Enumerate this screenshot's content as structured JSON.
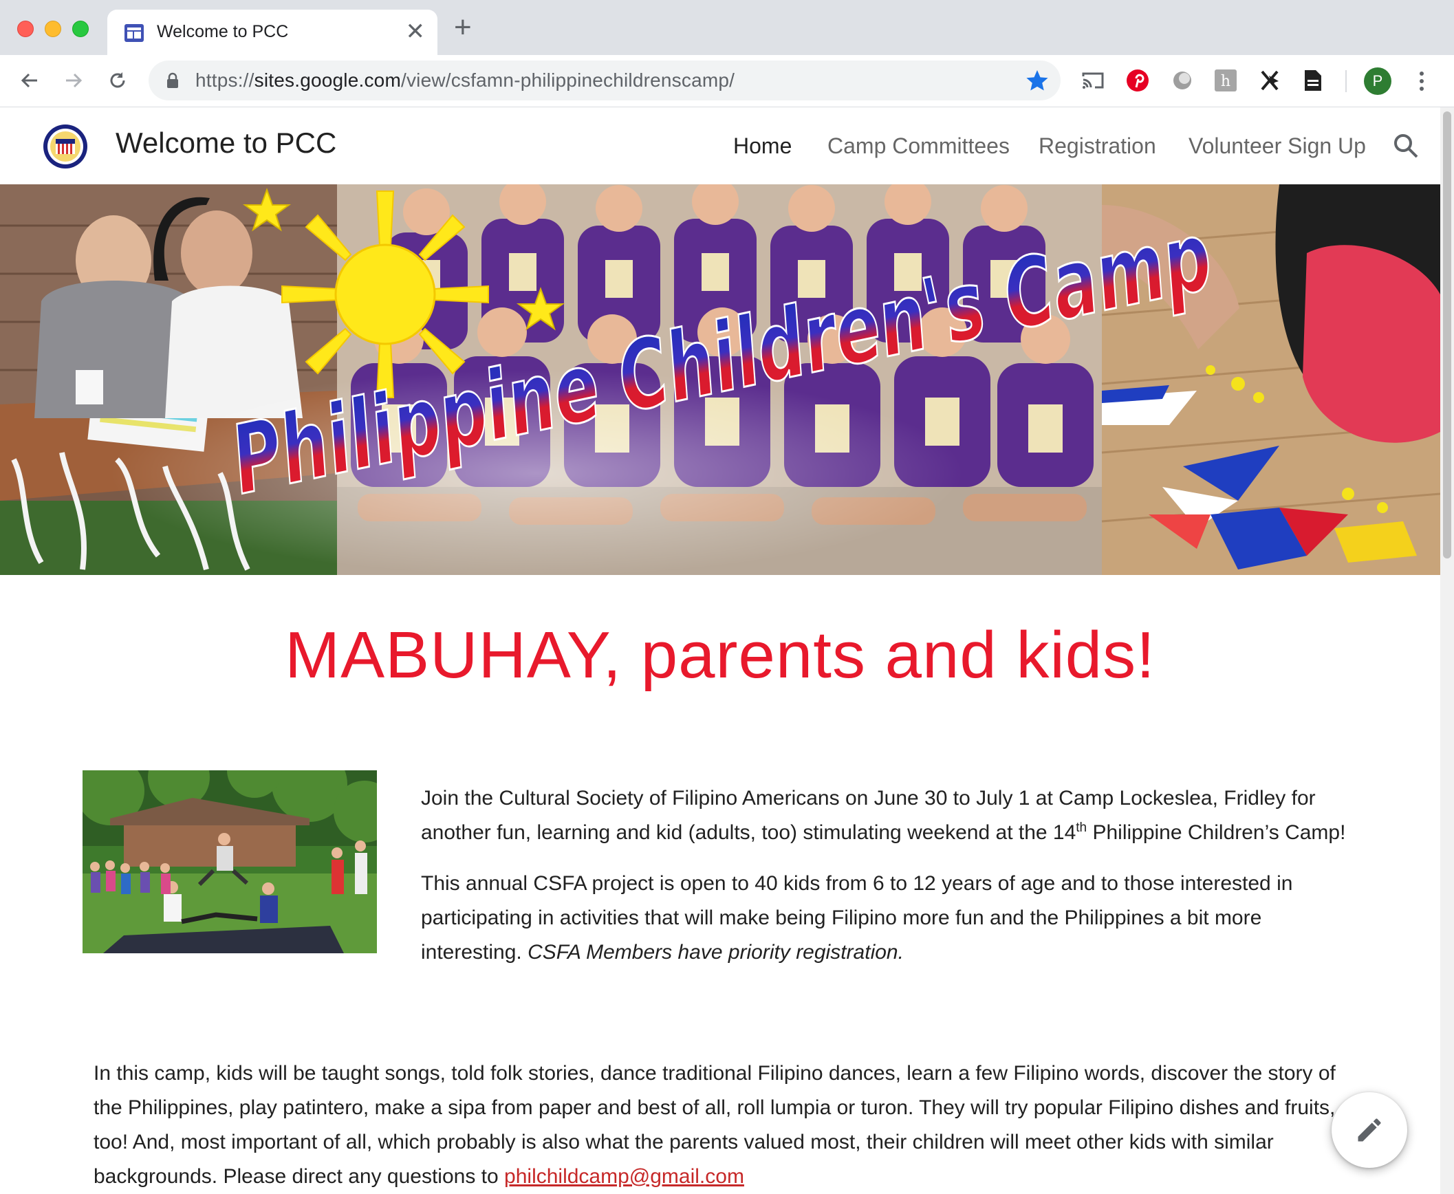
{
  "browser": {
    "tab_title": "Welcome to PCC",
    "tab_close": "✕",
    "new_tab": "+",
    "url_scheme": "https://",
    "url_host": "sites.google.com",
    "url_path": "/view/csfamn-philippinechildrenscamp/",
    "profile_initial": "P",
    "extensions": [
      "cast-icon",
      "pinterest-icon",
      "extension-grey-icon",
      "hk-icon",
      "x-cursor-icon",
      "doc-icon"
    ]
  },
  "site": {
    "title": "Welcome to PCC",
    "nav": [
      {
        "label": "Home",
        "active": true
      },
      {
        "label": "Camp Committees",
        "active": false
      },
      {
        "label": "Registration",
        "active": false
      },
      {
        "label": "Volunteer Sign Up",
        "active": false
      }
    ],
    "banner_text": "Philippine Children's Camp",
    "headline": "MABUHAY, parents and kids!",
    "intro": {
      "p1_a": "Join the Cultural Society of Filipino Americans on June 30 to July 1 at Camp Lockeslea, Fridley for another fun, learning and kid (adults, too) stimulating weekend at the 14",
      "p1_sup": "th",
      "p1_b": " Philippine Children’s Camp!",
      "p2_a": "This annual CSFA project is open to 40  kids from 6 to 12 years of age and to those interested in participating in activities that will make being Filipino more fun and the Philippines a bit more interesting. ",
      "p2_em": "CSFA Members have priority registration."
    },
    "body": {
      "text": "In this camp, kids will be taught songs, told folk stories, dance traditional Filipino dances, learn a few Filipino words, discover the story of the Philippines, play patintero, make a sipa from paper and best of all, roll lumpia or turon. They will try popular Filipino dishes and fruits, too! And, most important of all, which probably is also what the parents valued most,  their children will meet other kids with similar backgrounds.  Please direct any questions to ",
      "email": "philchildcamp@gmail.com"
    }
  },
  "colors": {
    "headline_red": "#e8192c",
    "banner_purple": "#5b2d8e",
    "banner_blue": "#1a2fb8",
    "banner_red": "#e01b2b",
    "sun_yellow": "#ffe81a"
  }
}
